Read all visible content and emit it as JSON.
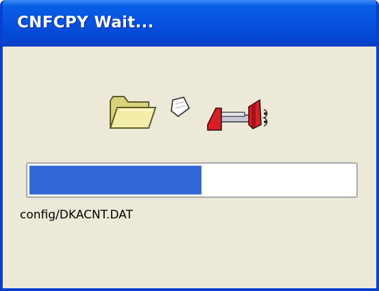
{
  "window": {
    "title": "CNFCPY Wait..."
  },
  "animation": {
    "icons": [
      "folder-icon",
      "flying-paper-icon",
      "recycle-shredder-icon"
    ]
  },
  "progress": {
    "value": 0.53
  },
  "status": {
    "current_file": "config/DKACNT.DAT"
  },
  "colors": {
    "titlebar": "#0553e0",
    "window_bg": "#ece9d8",
    "progress_fill": "#3168d5"
  }
}
